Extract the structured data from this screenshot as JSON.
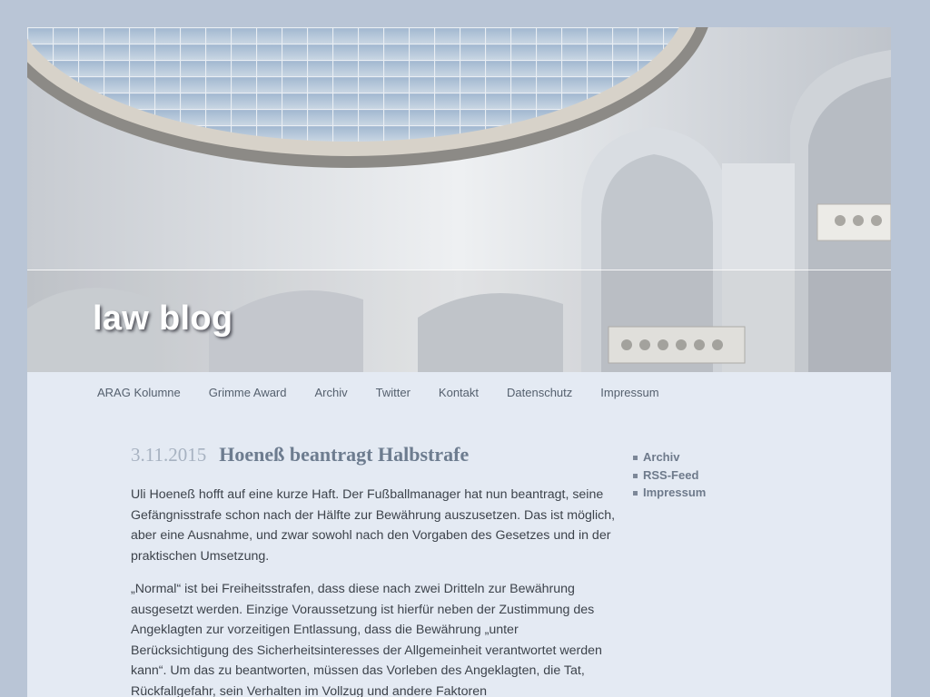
{
  "site": {
    "title": "law blog"
  },
  "nav": {
    "items": [
      {
        "label": "ARAG Kolumne"
      },
      {
        "label": "Grimme Award"
      },
      {
        "label": "Archiv"
      },
      {
        "label": "Twitter"
      },
      {
        "label": "Kontakt"
      },
      {
        "label": "Datenschutz"
      },
      {
        "label": "Impressum"
      }
    ]
  },
  "post": {
    "date": "3.11.2015",
    "title": "Hoeneß beantragt Halbstrafe",
    "paragraphs": [
      "Uli Hoeneß hofft auf eine kurze Haft. Der Fußballmanager hat nun beantragt, seine Gefängnisstrafe schon nach der Hälfte zur Bewährung auszusetzen. Das ist möglich, aber eine Ausnahme, und zwar sowohl nach den Vorgaben des Gesetzes und in der praktischen Umsetzung.",
      "„Normal“ ist bei Freiheitsstrafen, dass diese nach zwei Dritteln zur Bewährung ausgesetzt werden. Einzige Voraussetzung ist hierfür neben der Zustimmung des Angeklagten zur vorzeitigen Entlassung, dass die Bewährung „unter Berücksichtigung des Sicherheitsinteresses der Allgemeinheit verantwortet werden kann“. Um das zu beantworten, müssen das Vorleben des Angeklagten, die Tat, Rückfallgefahr, sein Verhalten im Vollzug und andere Faktoren"
    ]
  },
  "sidebar": {
    "links": [
      {
        "label": "Archiv"
      },
      {
        "label": "RSS-Feed"
      },
      {
        "label": "Impressum"
      }
    ]
  },
  "colors": {
    "background": "#b9c5d6",
    "page": "#e4eaf3",
    "nav_text": "#55606e",
    "post_title": "#6d7c8f",
    "post_date": "#a7b2c1",
    "body_text": "#3d434b"
  }
}
